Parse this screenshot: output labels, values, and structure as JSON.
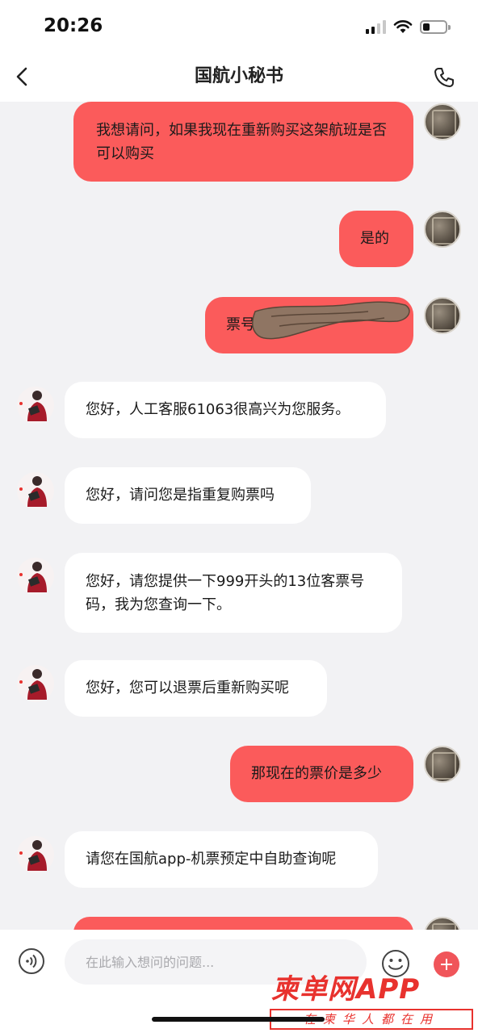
{
  "status": {
    "time": "20:26"
  },
  "nav": {
    "title": "国航小秘书"
  },
  "messages": [
    {
      "from": "user",
      "text": "我想请问，如果我现在重新购买这架航班是否可以购买"
    },
    {
      "from": "user",
      "text": "是的"
    },
    {
      "from": "user",
      "text": "票号："
    },
    {
      "from": "agent",
      "text": "您好，人工客服61063很高兴为您服务。"
    },
    {
      "from": "agent",
      "text": "您好，请问您是指重复购票吗"
    },
    {
      "from": "agent",
      "text": "您好，请您提供一下999开头的13位客票号码，我为您查询一下。"
    },
    {
      "from": "agent",
      "text": "您好，您可以退票后重新购买呢"
    },
    {
      "from": "user",
      "text": "那现在的票价是多少"
    },
    {
      "from": "agent",
      "text": "请您在国航app-机票预定中自助查询呢"
    }
  ],
  "input": {
    "placeholder": "在此输入想问的问题..."
  },
  "watermark": {
    "main": "柬单网APP",
    "sub": "在柬华人都在用"
  },
  "colors": {
    "user_bubble": "#fb5b5b",
    "agent_bubble": "#ffffff",
    "background": "#f2f2f4",
    "accent": "#f0555a"
  }
}
